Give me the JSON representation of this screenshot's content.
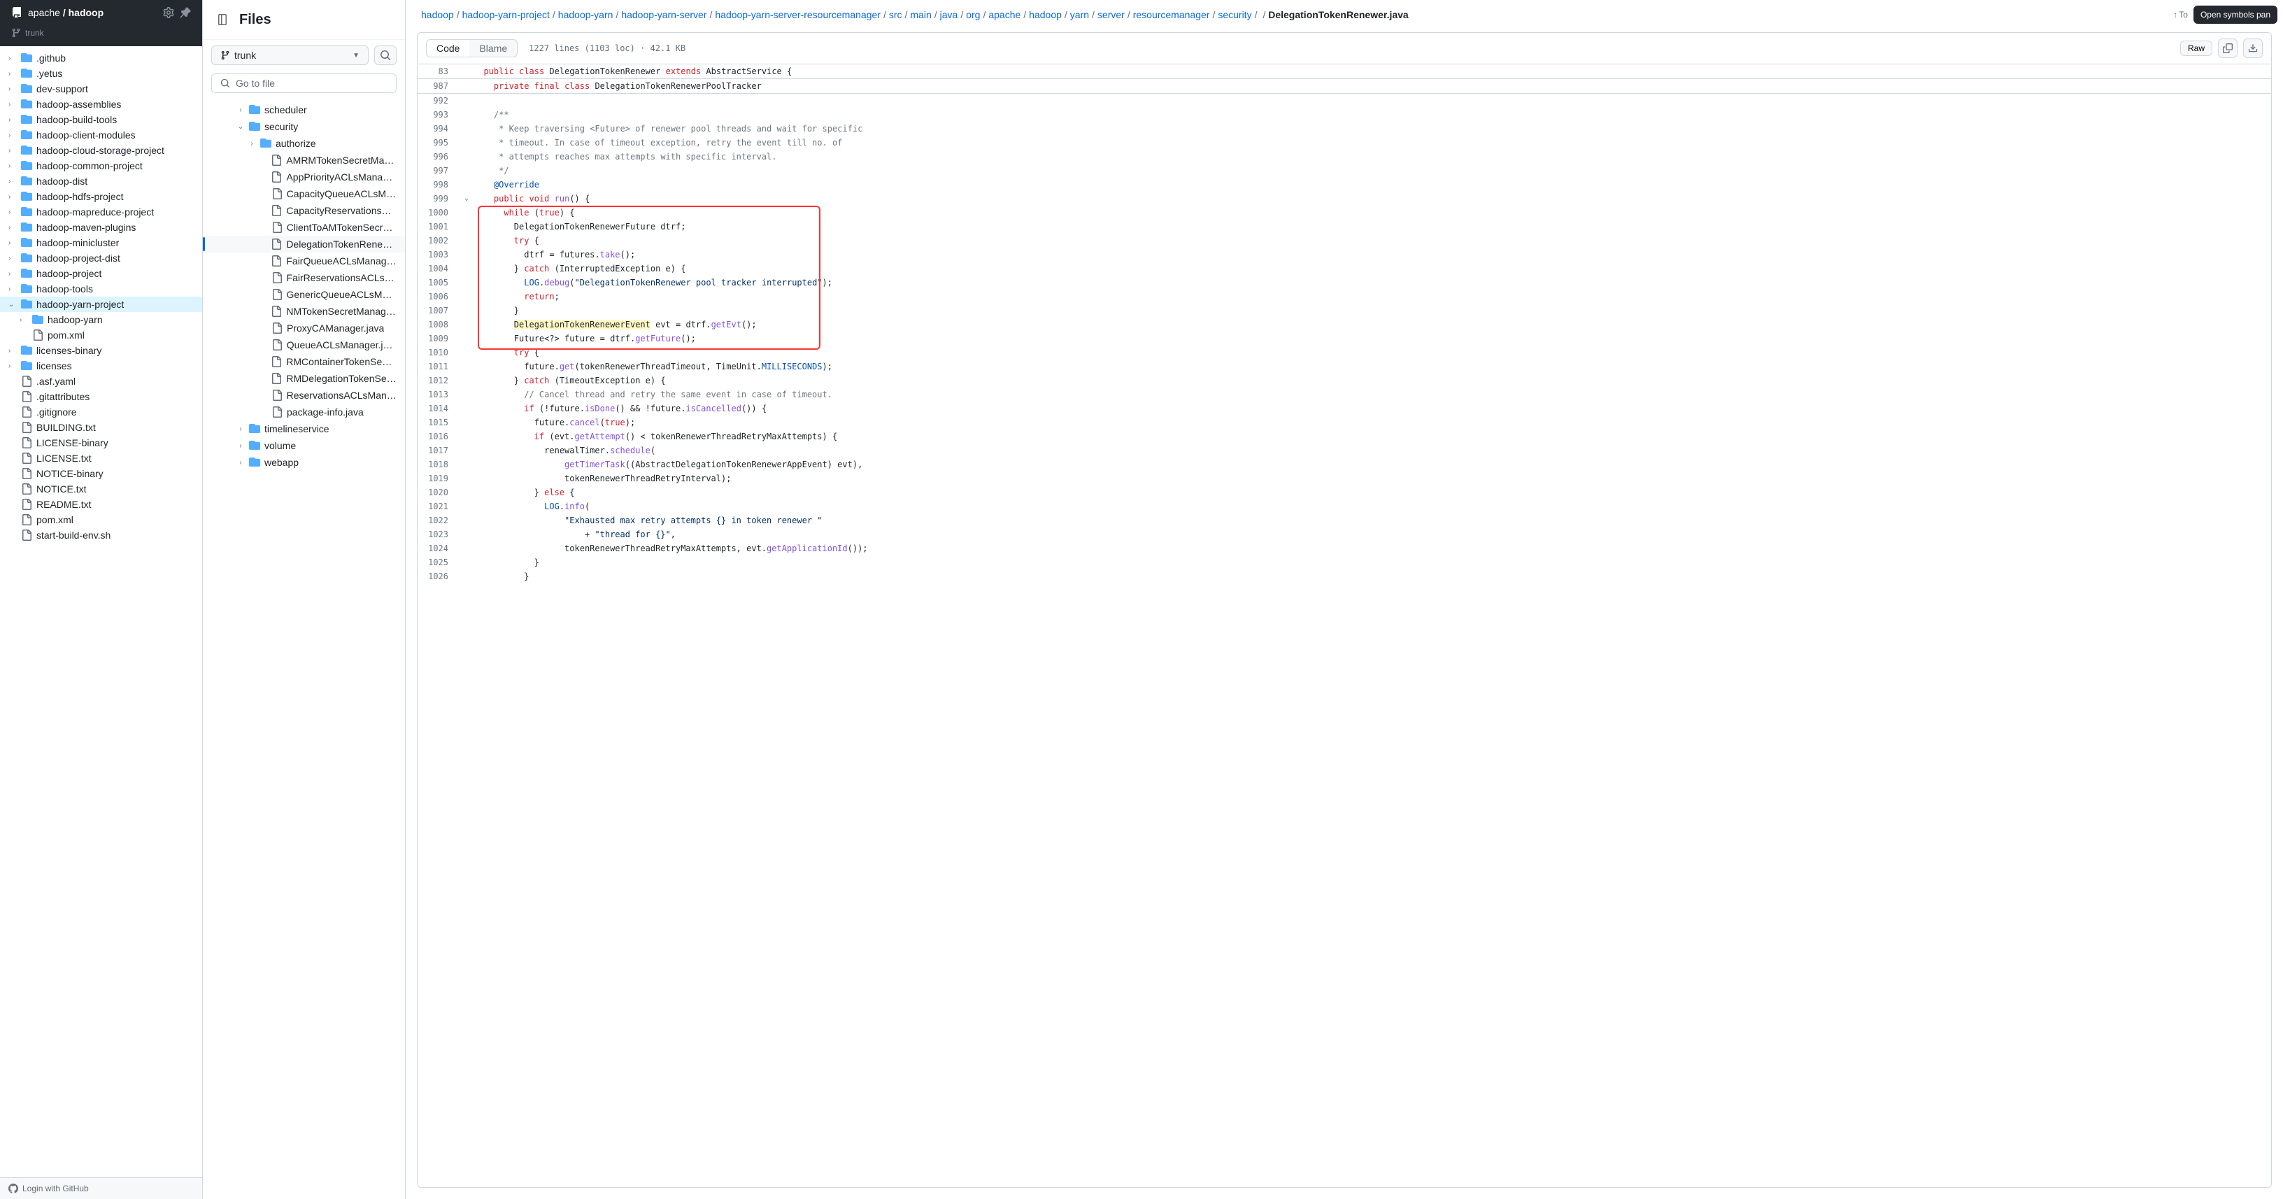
{
  "repo": {
    "owner": "apache",
    "name": "hadoop",
    "branch": "trunk"
  },
  "left_tree": [
    {
      "name": ".github",
      "type": "folder",
      "chev": "›"
    },
    {
      "name": ".yetus",
      "type": "folder",
      "chev": "›"
    },
    {
      "name": "dev-support",
      "type": "folder",
      "chev": "›"
    },
    {
      "name": "hadoop-assemblies",
      "type": "folder",
      "chev": "›"
    },
    {
      "name": "hadoop-build-tools",
      "type": "folder",
      "chev": "›"
    },
    {
      "name": "hadoop-client-modules",
      "type": "folder",
      "chev": "›"
    },
    {
      "name": "hadoop-cloud-storage-project",
      "type": "folder",
      "chev": "›"
    },
    {
      "name": "hadoop-common-project",
      "type": "folder",
      "chev": "›"
    },
    {
      "name": "hadoop-dist",
      "type": "folder",
      "chev": "›"
    },
    {
      "name": "hadoop-hdfs-project",
      "type": "folder",
      "chev": "›"
    },
    {
      "name": "hadoop-mapreduce-project",
      "type": "folder",
      "chev": "›"
    },
    {
      "name": "hadoop-maven-plugins",
      "type": "folder",
      "chev": "›"
    },
    {
      "name": "hadoop-minicluster",
      "type": "folder",
      "chev": "›"
    },
    {
      "name": "hadoop-project-dist",
      "type": "folder",
      "chev": "›"
    },
    {
      "name": "hadoop-project",
      "type": "folder",
      "chev": "›"
    },
    {
      "name": "hadoop-tools",
      "type": "folder",
      "chev": "›"
    },
    {
      "name": "hadoop-yarn-project",
      "type": "folder",
      "chev": "⌄",
      "active": true
    },
    {
      "name": "hadoop-yarn",
      "type": "folder",
      "chev": "›",
      "indent": 1
    },
    {
      "name": "pom.xml",
      "type": "file",
      "indent": 1
    },
    {
      "name": "licenses-binary",
      "type": "folder",
      "chev": "›"
    },
    {
      "name": "licenses",
      "type": "folder",
      "chev": "›"
    },
    {
      "name": ".asf.yaml",
      "type": "file"
    },
    {
      "name": ".gitattributes",
      "type": "file"
    },
    {
      "name": ".gitignore",
      "type": "file"
    },
    {
      "name": "BUILDING.txt",
      "type": "file"
    },
    {
      "name": "LICENSE-binary",
      "type": "file"
    },
    {
      "name": "LICENSE.txt",
      "type": "file"
    },
    {
      "name": "NOTICE-binary",
      "type": "file"
    },
    {
      "name": "NOTICE.txt",
      "type": "file"
    },
    {
      "name": "README.txt",
      "type": "file"
    },
    {
      "name": "pom.xml",
      "type": "file"
    },
    {
      "name": "start-build-env.sh",
      "type": "file"
    }
  ],
  "login_label": "Login with GitHub",
  "mid": {
    "title": "Files",
    "branch": "trunk",
    "goto_placeholder": "Go to file",
    "items": [
      {
        "type": "folder",
        "name": "scheduler",
        "chev": "›",
        "depth": 1
      },
      {
        "type": "folder",
        "name": "security",
        "chev": "⌄",
        "depth": 1
      },
      {
        "type": "folder",
        "name": "authorize",
        "chev": "›",
        "depth": 2
      },
      {
        "type": "file",
        "name": "AMRMTokenSecretMana...",
        "depth": 3
      },
      {
        "type": "file",
        "name": "AppPriorityACLsManage...",
        "depth": 3
      },
      {
        "type": "file",
        "name": "CapacityQueueACLsMa...",
        "depth": 3
      },
      {
        "type": "file",
        "name": "CapacityReservationsAC...",
        "depth": 3
      },
      {
        "type": "file",
        "name": "ClientToAMTokenSecret...",
        "depth": 3
      },
      {
        "type": "file",
        "name": "DelegationTokenRenewe...",
        "depth": 3,
        "selected": true
      },
      {
        "type": "file",
        "name": "FairQueueACLsManager...",
        "depth": 3
      },
      {
        "type": "file",
        "name": "FairReservationsACLsM...",
        "depth": 3
      },
      {
        "type": "file",
        "name": "GenericQueueACLsMan...",
        "depth": 3
      },
      {
        "type": "file",
        "name": "NMTokenSecretManager...",
        "depth": 3
      },
      {
        "type": "file",
        "name": "ProxyCAManager.java",
        "depth": 3
      },
      {
        "type": "file",
        "name": "QueueACLsManager.java",
        "depth": 3
      },
      {
        "type": "file",
        "name": "RMContainerTokenSecre...",
        "depth": 3
      },
      {
        "type": "file",
        "name": "RMDelegationTokenSecr...",
        "depth": 3
      },
      {
        "type": "file",
        "name": "ReservationsACLsMana...",
        "depth": 3
      },
      {
        "type": "file",
        "name": "package-info.java",
        "depth": 3
      },
      {
        "type": "folder",
        "name": "timelineservice",
        "chev": "›",
        "depth": 1
      },
      {
        "type": "folder",
        "name": "volume",
        "chev": "›",
        "depth": 1
      },
      {
        "type": "folder",
        "name": "webapp",
        "chev": "›",
        "depth": 1
      }
    ]
  },
  "breadcrumb": [
    "hadoop",
    "hadoop-yarn-project",
    "hadoop-yarn",
    "hadoop-yarn-server",
    "hadoop-yarn-server-resourcemanager",
    "src",
    "main",
    "java",
    "org",
    "apache",
    "hadoop",
    "yarn",
    "server",
    "resourcemanager",
    "security"
  ],
  "current_file": "DelegationTokenRenewer.java",
  "tooltip": "Open symbols pan",
  "totop": "To",
  "tabs": {
    "code": "Code",
    "blame": "Blame"
  },
  "file_info": "1227 lines (1103 loc) · 42.1 KB",
  "raw_label": "Raw",
  "sticky": [
    {
      "no": "83",
      "html": "  <span class='kw'>public</span> <span class='kw'>class</span> <span class='cls'>DelegationTokenRenewer</span> <span class='kw'>extends</span> <span class='cls'>AbstractService</span> {"
    },
    {
      "no": "987",
      "html": "    <span class='kw'>private</span> <span class='kw'>final</span> <span class='kw'>class</span> <span class='cls'>DelegationTokenRenewerPoolTracker</span>"
    }
  ],
  "code_lines": [
    {
      "no": "992",
      "html": ""
    },
    {
      "no": "993",
      "html": "    <span class='cmt'>/**</span>"
    },
    {
      "no": "994",
      "html": "     <span class='cmt'>* Keep traversing &lt;Future&gt; of renewer pool threads and wait for specific</span>"
    },
    {
      "no": "995",
      "html": "     <span class='cmt'>* timeout. In case of timeout exception, retry the event till no. of</span>"
    },
    {
      "no": "996",
      "html": "     <span class='cmt'>* attempts reaches max attempts with specific interval.</span>"
    },
    {
      "no": "997",
      "html": "     <span class='cmt'>*/</span>"
    },
    {
      "no": "998",
      "html": "    <span class='ann'>@Override</span>"
    },
    {
      "no": "999",
      "fold": "⌄",
      "html": "    <span class='kw'>public</span> <span class='kw'>void</span> <span class='fn'>run</span>() {"
    },
    {
      "no": "1000",
      "html": "      <span class='kw'>while</span> (<span class='kw'>true</span>) {"
    },
    {
      "no": "1001",
      "html": "        DelegationTokenRenewerFuture dtrf;"
    },
    {
      "no": "1002",
      "html": "        <span class='kw'>try</span> {"
    },
    {
      "no": "1003",
      "html": "          dtrf = futures.<span class='fn'>take</span>();"
    },
    {
      "no": "1004",
      "html": "        } <span class='kw'>catch</span> (InterruptedException e) {"
    },
    {
      "no": "1005",
      "html": "          <span class='const'>LOG</span>.<span class='fn'>debug</span>(<span class='str'>\"DelegationTokenRenewer pool tracker interrupted\"</span>);"
    },
    {
      "no": "1006",
      "html": "          <span class='kw'>return</span>;"
    },
    {
      "no": "1007",
      "html": "        }"
    },
    {
      "no": "1008",
      "html": "        <span class='hl'>DelegationTokenRenewerEvent</span> evt = dtrf.<span class='fn'>getEvt</span>();"
    },
    {
      "no": "1009",
      "html": "        Future&lt;?&gt; future = dtrf.<span class='fn'>getFuture</span>();"
    },
    {
      "no": "1010",
      "html": "        <span class='kw'>try</span> {"
    },
    {
      "no": "1011",
      "html": "          future.<span class='fn'>get</span>(tokenRenewerThreadTimeout, TimeUnit.<span class='const'>MILLISECONDS</span>);"
    },
    {
      "no": "1012",
      "html": "        } <span class='kw'>catch</span> (TimeoutException e) {"
    },
    {
      "no": "1013",
      "html": "          <span class='cmt'>// Cancel thread and retry the same event in case of timeout.</span>"
    },
    {
      "no": "1014",
      "html": "          <span class='kw'>if</span> (!future.<span class='fn'>isDone</span>() && !future.<span class='fn'>isCancelled</span>()) {"
    },
    {
      "no": "1015",
      "html": "            future.<span class='fn'>cancel</span>(<span class='kw'>true</span>);"
    },
    {
      "no": "1016",
      "html": "            <span class='kw'>if</span> (evt.<span class='fn'>getAttempt</span>() &lt; tokenRenewerThreadRetryMaxAttempts) {"
    },
    {
      "no": "1017",
      "html": "              renewalTimer.<span class='fn'>schedule</span>("
    },
    {
      "no": "1018",
      "html": "                  <span class='fn'>getTimerTask</span>((AbstractDelegationTokenRenewerAppEvent) evt),"
    },
    {
      "no": "1019",
      "html": "                  tokenRenewerThreadRetryInterval);"
    },
    {
      "no": "1020",
      "html": "            } <span class='kw'>else</span> {"
    },
    {
      "no": "1021",
      "html": "              <span class='const'>LOG</span>.<span class='fn'>info</span>("
    },
    {
      "no": "1022",
      "html": "                  <span class='str'>\"Exhausted max retry attempts {} in token renewer \"</span>"
    },
    {
      "no": "1023",
      "html": "                      + <span class='str'>\"thread for {}\"</span>,"
    },
    {
      "no": "1024",
      "html": "                  tokenRenewerThreadRetryMaxAttempts, evt.<span class='fn'>getApplicationId</span>());"
    },
    {
      "no": "1025",
      "html": "            }"
    },
    {
      "no": "1026",
      "html": "          }"
    }
  ]
}
